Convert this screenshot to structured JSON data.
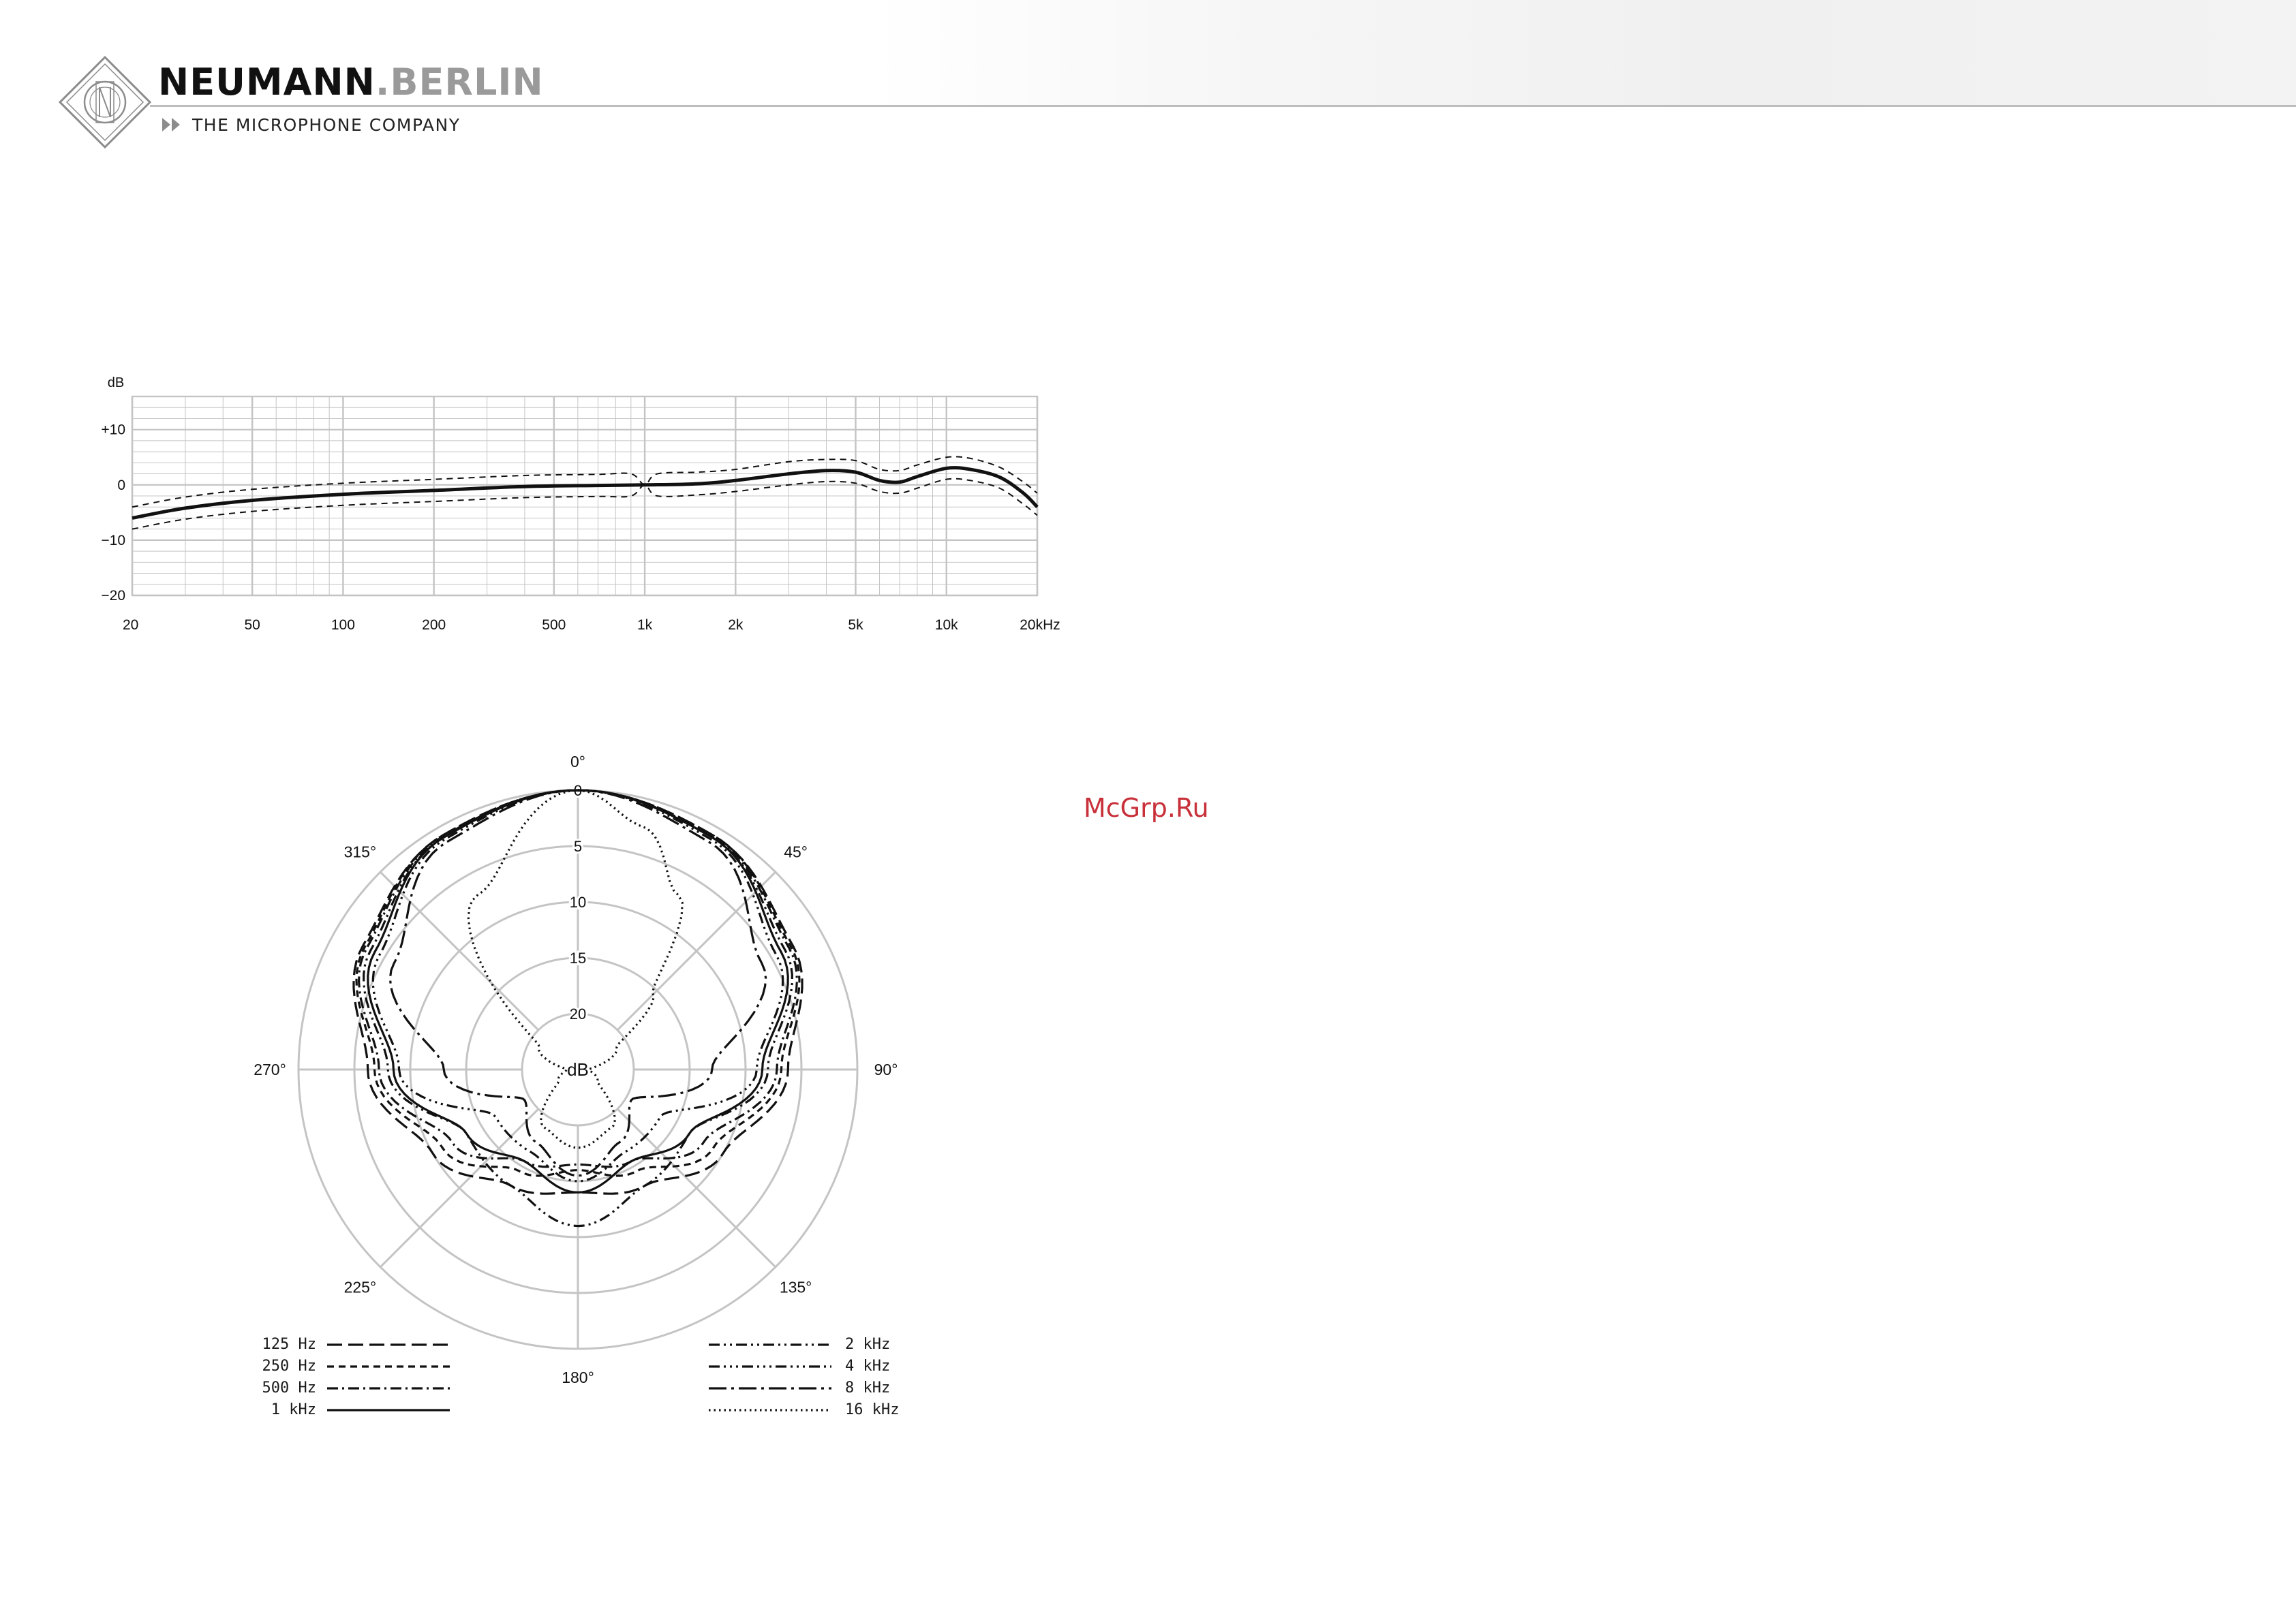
{
  "header": {
    "brand_name": "NEUMANN",
    "brand_dot": ".",
    "brand_city": "BERLIN",
    "tagline": "THE MICROPHONE COMPANY",
    "logo_icon": "neumann-diamond-logo-icon"
  },
  "watermark": "McGrp.Ru",
  "colors": {
    "grid": "#c4c4c4",
    "curve": "#111111",
    "watermark": "#c8303a",
    "header_rule": "#bdbdbd"
  },
  "chart_data": [
    {
      "type": "line",
      "ylabel": "dB",
      "x_scale": "log",
      "xlim": [
        20,
        20000
      ],
      "ylim": [
        -20,
        16
      ],
      "grid": true,
      "x_ticks": [
        {
          "value": 20,
          "label": "20"
        },
        {
          "value": 50,
          "label": "50"
        },
        {
          "value": 100,
          "label": "100"
        },
        {
          "value": 200,
          "label": "200"
        },
        {
          "value": 500,
          "label": "500"
        },
        {
          "value": 1000,
          "label": "1k"
        },
        {
          "value": 2000,
          "label": "2k"
        },
        {
          "value": 5000,
          "label": "5k"
        },
        {
          "value": 10000,
          "label": "10k"
        },
        {
          "value": 20000,
          "label": "20kHz"
        }
      ],
      "y_ticks": [
        {
          "value": 10,
          "label": "+10"
        },
        {
          "value": 0,
          "label": "0"
        },
        {
          "value": -10,
          "label": "−10"
        },
        {
          "value": -20,
          "label": "−20"
        }
      ],
      "series": [
        {
          "style": "solid",
          "x": [
            20,
            30,
            50,
            100,
            200,
            400,
            700,
            1000,
            1500,
            2000,
            3000,
            4000,
            5000,
            6000,
            7000,
            8000,
            10000,
            12000,
            15000,
            18000,
            20000
          ],
          "y": [
            -6,
            -4.2,
            -2.8,
            -1.7,
            -1.0,
            -0.3,
            -0.1,
            0,
            0.2,
            0.8,
            2.0,
            2.6,
            2.3,
            0.8,
            0.5,
            1.5,
            3.0,
            2.8,
            1.4,
            -1.5,
            -4.0
          ]
        },
        {
          "style": "dashed",
          "x": [
            20,
            30,
            50,
            100,
            200,
            400,
            700,
            900,
            1000,
            1100,
            1500,
            2000,
            3000,
            4000,
            5000,
            6000,
            7000,
            8000,
            10000,
            12000,
            15000,
            18000,
            20000
          ],
          "y": [
            -4,
            -2.2,
            -0.8,
            0.3,
            1.0,
            1.7,
            1.9,
            2.0,
            0,
            2.0,
            2.3,
            2.8,
            4.2,
            4.6,
            4.4,
            2.8,
            2.6,
            3.6,
            5.0,
            4.8,
            3.2,
            0.5,
            -1.5
          ]
        },
        {
          "style": "dashed",
          "x": [
            20,
            30,
            50,
            100,
            200,
            400,
            700,
            900,
            1000,
            1100,
            1500,
            2000,
            3000,
            4000,
            5000,
            6000,
            7000,
            8000,
            10000,
            12000,
            15000,
            18000,
            20000
          ],
          "y": [
            -8,
            -6.2,
            -4.8,
            -3.7,
            -3.0,
            -2.3,
            -2.1,
            -2.0,
            0,
            -2.0,
            -1.8,
            -1.2,
            0,
            0.6,
            0.3,
            -1.2,
            -1.5,
            -0.6,
            1.0,
            0.8,
            -0.6,
            -3.5,
            -5.5
          ]
        }
      ]
    },
    {
      "type": "polar",
      "center_label": "dB",
      "r_unit": "dB attenuation",
      "rlim": [
        0,
        25
      ],
      "r_ticks": [
        {
          "value": 0,
          "label": "0"
        },
        {
          "value": 5,
          "label": "5"
        },
        {
          "value": 10,
          "label": "10"
        },
        {
          "value": 15,
          "label": "15"
        },
        {
          "value": 20,
          "label": "20"
        }
      ],
      "angle_ticks": [
        {
          "value": 0,
          "label": "0°"
        },
        {
          "value": 45,
          "label": "45°"
        },
        {
          "value": 90,
          "label": "90°"
        },
        {
          "value": 135,
          "label": "135°"
        },
        {
          "value": 180,
          "label": "180°"
        },
        {
          "value": 225,
          "label": "225°"
        },
        {
          "value": 270,
          "label": "270°"
        },
        {
          "value": 315,
          "label": "315°"
        }
      ],
      "grid": true,
      "series": [
        {
          "name": "125 Hz",
          "style": "dash-long",
          "angle": [
            0,
            30,
            60,
            90,
            120,
            150,
            180,
            210,
            240,
            270,
            300,
            330,
            360
          ],
          "attenuation": [
            0,
            0.8,
            2.8,
            6.2,
            10.0,
            13.0,
            14.0,
            13.0,
            10.0,
            6.2,
            2.8,
            0.8,
            0
          ]
        },
        {
          "name": "250 Hz",
          "style": "dash-short",
          "angle": [
            0,
            30,
            60,
            90,
            120,
            150,
            180,
            210,
            240,
            270,
            300,
            330,
            360
          ],
          "attenuation": [
            0,
            0.8,
            3.0,
            6.8,
            11.0,
            14.5,
            16.0,
            14.5,
            11.0,
            6.8,
            3.0,
            0.8,
            0
          ]
        },
        {
          "name": "500 Hz",
          "style": "dash-dot",
          "angle": [
            0,
            30,
            60,
            90,
            120,
            150,
            180,
            210,
            240,
            270,
            300,
            330,
            360
          ],
          "attenuation": [
            0,
            0.9,
            3.2,
            7.2,
            12.0,
            15.5,
            16.5,
            15.5,
            12.0,
            7.2,
            3.2,
            0.9,
            0
          ]
        },
        {
          "name": "1 kHz",
          "style": "solid",
          "angle": [
            0,
            30,
            60,
            90,
            120,
            150,
            180,
            210,
            240,
            270,
            300,
            330,
            360
          ],
          "attenuation": [
            0,
            1.0,
            4.0,
            8.5,
            13.5,
            15.5,
            14.0,
            15.5,
            13.5,
            8.5,
            4.0,
            1.0,
            0
          ]
        },
        {
          "name": "2 kHz",
          "style": "dash-dot-dot",
          "angle": [
            0,
            30,
            60,
            90,
            120,
            150,
            180,
            210,
            240,
            270,
            300,
            330,
            360
          ],
          "attenuation": [
            0,
            1.0,
            3.6,
            8.0,
            13.5,
            13.0,
            11.0,
            13.0,
            13.5,
            8.0,
            3.6,
            1.0,
            0
          ]
        },
        {
          "name": "4 kHz",
          "style": "dash-dot-dot-dot",
          "angle": [
            0,
            30,
            60,
            90,
            120,
            150,
            180,
            210,
            240,
            270,
            300,
            330,
            360
          ],
          "attenuation": [
            0,
            1.2,
            4.5,
            9.0,
            16.5,
            16.5,
            15.0,
            16.5,
            16.5,
            9.0,
            4.5,
            1.2,
            0
          ]
        },
        {
          "name": "8 kHz",
          "style": "dash-long-dot",
          "angle": [
            0,
            30,
            60,
            90,
            120,
            150,
            180,
            210,
            240,
            270,
            300,
            330,
            360
          ],
          "attenuation": [
            0,
            1.5,
            6.0,
            13.0,
            19.5,
            17.5,
            15.5,
            17.5,
            19.5,
            13.0,
            6.0,
            1.5,
            0
          ]
        },
        {
          "name": "16 kHz",
          "style": "dotted",
          "angle": [
            0,
            15,
            30,
            45,
            60,
            90,
            120,
            150,
            180,
            210,
            240,
            270,
            300,
            330,
            360
          ],
          "attenuation": [
            0,
            2.5,
            7.0,
            15.5,
            21.0,
            24.0,
            23.0,
            19.0,
            18.0,
            19.0,
            23.0,
            24.0,
            21.0,
            7.0,
            0
          ]
        }
      ]
    }
  ]
}
